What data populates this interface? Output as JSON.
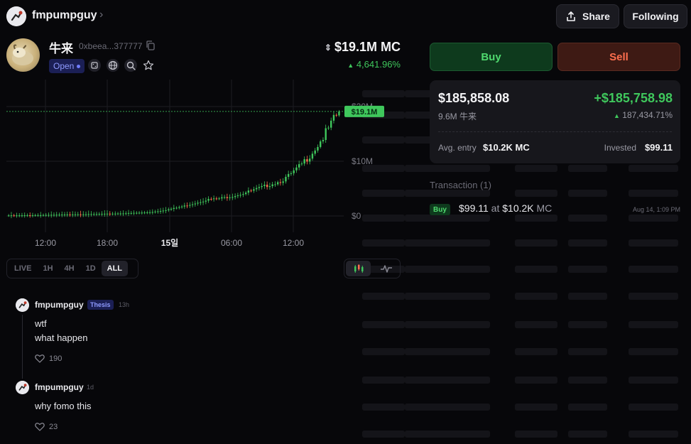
{
  "header": {
    "username": "fmpumpguy",
    "chevron": "›",
    "share_label": "Share",
    "following_label": "Following"
  },
  "token": {
    "name": "牛来",
    "address": "0xbeea...377777",
    "status": "Open",
    "market_cap": "$19.1M MC",
    "change": "4,641.96%",
    "icons": [
      "dice-icon",
      "globe-icon",
      "search-icon",
      "star-icon"
    ]
  },
  "chart": {
    "current_price_label": "$19.1M",
    "x_ticks": [
      "12:00",
      "18:00",
      "15일",
      "06:00",
      "12:00"
    ],
    "y_ticks": [
      "$20M",
      "$10M",
      "$0"
    ],
    "ranges": [
      "LIVE",
      "1H",
      "4H",
      "1D",
      "ALL"
    ],
    "active_range": "ALL",
    "colors": {
      "up": "#3fc75c",
      "down": "#ff6f4e",
      "price_line": "#3fc75c"
    }
  },
  "chart_data": {
    "type": "line",
    "title": "",
    "xlabel": "",
    "ylabel": "",
    "x": [
      "12:00",
      "18:00",
      "15일",
      "06:00",
      "12:00"
    ],
    "ylim": [
      0,
      20
    ],
    "series": [
      {
        "values": [
          0.1,
          0.3,
          0.6,
          3.0,
          6.0,
          19.1
        ]
      }
    ],
    "grid": true,
    "legend": "none"
  },
  "comments": [
    {
      "user": "fmpumpguy",
      "badge": "Thesis",
      "time": "13h",
      "lines": [
        "wtf",
        "what happen"
      ],
      "likes": "190"
    },
    {
      "user": "fmpumpguy",
      "badge": "",
      "time": "1d",
      "lines": [
        "why fomo this"
      ],
      "likes": "23"
    }
  ],
  "trade": {
    "buy_label": "Buy",
    "sell_label": "Sell"
  },
  "position": {
    "value": "$185,858.08",
    "pnl": "+$185,758.98",
    "amount": "9.6M 牛来",
    "pnl_pct": "187,434.71%",
    "avg_entry_label": "Avg. entry",
    "avg_entry": "$10.2K MC",
    "invested_label": "Invested",
    "invested": "$99.11"
  },
  "transactions": {
    "header": "Transaction (1)",
    "items": [
      {
        "type": "Buy",
        "amount": "$99.11",
        "at": "at",
        "mc": "$10.2K",
        "mc_unit": "MC",
        "time": "Aug 14, 1:09 PM"
      }
    ]
  }
}
